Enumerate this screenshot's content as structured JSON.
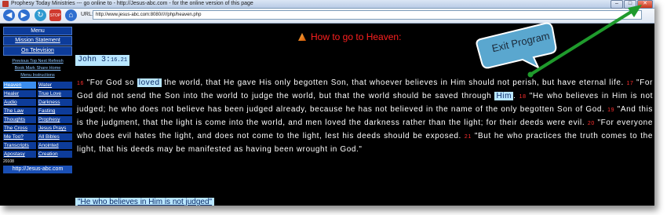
{
  "window": {
    "title": "Prophesy Today Ministries   ---   go online to - http://Jesus-abc.com - for the online version of this page"
  },
  "toolbar": {
    "url_label": "URL:",
    "url_value": "http://www.jesus-abc.com:8080/////php/heaven.php",
    "buttons": [
      {
        "name": "back",
        "icon": "back-arrow-icon",
        "color": "#2f6fd0"
      },
      {
        "name": "forward",
        "icon": "forward-arrow-icon",
        "color": "#2f6fd0"
      },
      {
        "name": "refresh",
        "icon": "refresh-icon",
        "color": "#2f9ad0"
      },
      {
        "name": "stop",
        "icon": "stop-icon",
        "color": "#d03a2f"
      },
      {
        "name": "home",
        "icon": "home-icon",
        "color": "#2f6fd0"
      }
    ]
  },
  "menu": {
    "header": "Menu",
    "mission": "Mission Statement",
    "television": "On Television",
    "small_row1": "Previous  Top  Next  Refresh",
    "small_row2": "Book Mark  Share  Home",
    "small_row3": "Menu Instructions",
    "items": [
      {
        "label": "Heaven",
        "selected": true
      },
      {
        "label": "Water",
        "selected": false
      },
      {
        "label": "Healer",
        "selected": false
      },
      {
        "label": "True Love",
        "selected": false
      },
      {
        "label": "Audio",
        "selected": false
      },
      {
        "label": "Darkness",
        "selected": false
      },
      {
        "label": "The Law",
        "selected": false
      },
      {
        "label": "Fasting",
        "selected": false
      },
      {
        "label": "Thoughts",
        "selected": false
      },
      {
        "label": "Prophesy",
        "selected": false
      },
      {
        "label": "The Cross",
        "selected": false
      },
      {
        "label": "Jesus Prays",
        "selected": false
      },
      {
        "label": "Me Too?",
        "selected": false
      },
      {
        "label": "All Bibles",
        "selected": false
      },
      {
        "label": "Transcripts",
        "selected": false
      },
      {
        "label": "Anointed",
        "selected": false
      },
      {
        "label": "Apostasy",
        "selected": false
      },
      {
        "label": "Creation",
        "selected": false
      }
    ],
    "stamp": "20108",
    "site": "http://Jesus-abc.com"
  },
  "main": {
    "heading": "How to go to Heaven:",
    "reference": "John 3:",
    "reference_verse": "16.21",
    "verses": {
      "v16_num": "16",
      "v16_a": "\"For God so ",
      "v16_hl": "loved",
      "v16_b": " the world, that He gave His only begotten Son, that whoever believes in Him should not perish, but have eternal life. ",
      "v17_num": "17",
      "v17_a": " \"For God did not send the Son into the world to judge the world, but that the world should be saved through ",
      "v17_hl": "Him",
      "v17_b": ". ",
      "v18_num": "18",
      "v18": " \"He who believes in Him is not judged; he who does not believe has been judged already, because he has not believed in the name of the only begotten Son of God. ",
      "v19_num": "19",
      "v19": " \"And this is the judgment, that the light is come into the world, and men loved the darkness rather than the light; for their deeds were evil. ",
      "v20_num": "20",
      "v20": " \"For everyone who does evil hates the light, and does not come to the light, lest his deeds should be exposed. ",
      "v21_num": "21",
      "v21": " \"But he who practices the truth comes to the light, that his deeds may be manifested as having been wrought in God.\""
    },
    "quote": "\"He who believes in Him is not judged\""
  },
  "callout": {
    "text": "Exit Program",
    "fill": "#5aa7cf",
    "arrow_color": "#1f9a2c"
  }
}
